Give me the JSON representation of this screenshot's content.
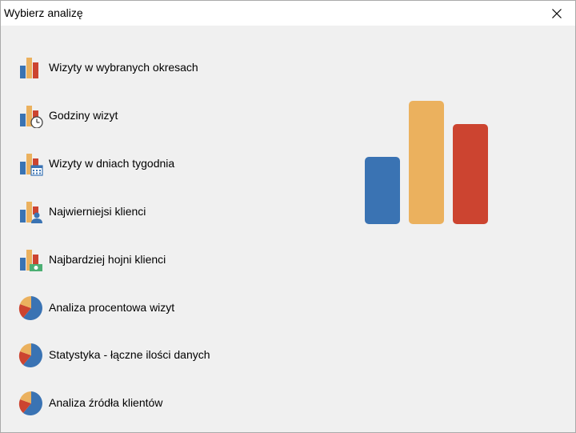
{
  "window": {
    "title": "Wybierz analizę"
  },
  "items": [
    {
      "label": "Wizyty w wybranych okresach",
      "icon": "bar-chart-icon"
    },
    {
      "label": "Godziny wizyt",
      "icon": "bar-chart-clock-icon"
    },
    {
      "label": "Wizyty w dniach tygodnia",
      "icon": "bar-chart-calendar-icon"
    },
    {
      "label": "Najwierniejsi klienci",
      "icon": "bar-chart-person-icon"
    },
    {
      "label": "Najbardziej hojni klienci",
      "icon": "bar-chart-money-icon"
    },
    {
      "label": "Analiza procentowa wizyt",
      "icon": "pie-chart-icon"
    },
    {
      "label": "Statystyka - łączne ilości danych",
      "icon": "pie-chart-icon"
    },
    {
      "label": "Analiza źródła klientów",
      "icon": "pie-chart-icon"
    }
  ],
  "colors": {
    "blue": "#3a73b3",
    "yellow": "#ebb15e",
    "red": "#cc4430"
  }
}
